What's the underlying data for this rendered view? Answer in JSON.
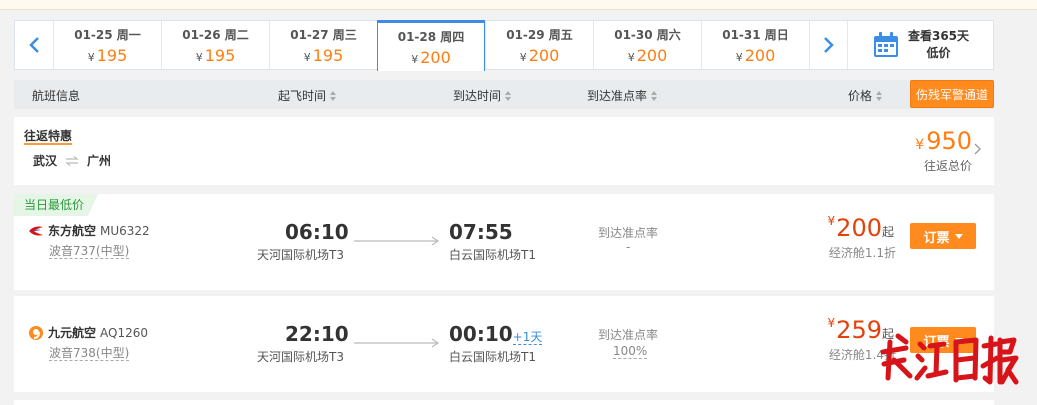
{
  "date_bar": {
    "dates": [
      {
        "date": "01-25 周一",
        "price": "195"
      },
      {
        "date": "01-26 周二",
        "price": "195"
      },
      {
        "date": "01-27 周三",
        "price": "195"
      },
      {
        "date": "01-28 周四",
        "price": "200"
      },
      {
        "date": "01-29 周五",
        "price": "200"
      },
      {
        "date": "01-30 周六",
        "price": "200"
      },
      {
        "date": "01-31 周日",
        "price": "200"
      }
    ],
    "active_index": 3,
    "currency": "¥",
    "calendar_label_line1": "查看365天",
    "calendar_label_line2": "低价"
  },
  "header": {
    "flight_info": "航班信息",
    "depart_time": "起飞时间",
    "arrive_time": "到达时间",
    "on_time_rate": "到达准点率",
    "price": "价格",
    "military_channel": "伤残军警通道"
  },
  "round_trip": {
    "title": "往返特惠",
    "from": "武汉",
    "to": "广州",
    "currency": "¥",
    "price": "950",
    "subtitle": "往返总价"
  },
  "flights": [
    {
      "badge": "当日最低价",
      "airline": "东方航空",
      "code": "MU6322",
      "plane": "波音737(中型)",
      "depart_time": "06:10",
      "depart_airport": "天河国际机场T3",
      "arrive_time": "07:55",
      "arrive_plus": "",
      "arrive_airport": "白云国际机场T1",
      "ontime_label": "到达准点率",
      "ontime_value": "-",
      "currency": "¥",
      "price": "200",
      "price_suffix": "起",
      "cabin": "经济舱1.1折",
      "book_label": "订票"
    },
    {
      "badge": "",
      "airline": "九元航空",
      "code": "AQ1260",
      "plane": "波音738(中型)",
      "depart_time": "22:10",
      "depart_airport": "天河国际机场T3",
      "arrive_time": "00:10",
      "arrive_plus": "+1天",
      "arrive_airport": "白云国际机场T1",
      "ontime_label": "到达准点率",
      "ontime_value": "100%",
      "currency": "¥",
      "price": "259",
      "price_suffix": "起",
      "cabin": "经济舱1.4折",
      "book_label": "订票"
    }
  ],
  "watermark_text": "长江日报",
  "colors": {
    "accent_orange": "#ff8a1d",
    "price_red": "#e2430e",
    "price_orange": "#ff7d13",
    "active_blue": "#3a8ee6",
    "watermark_red": "#d7141a"
  },
  "icons": [
    "chevron-left-icon",
    "chevron-right-icon",
    "calendar-icon",
    "swap-icon",
    "sort-icon",
    "arrow-right-icon",
    "china-eastern-logo-icon",
    "9air-logo-icon",
    "dropdown-triangle-icon"
  ]
}
